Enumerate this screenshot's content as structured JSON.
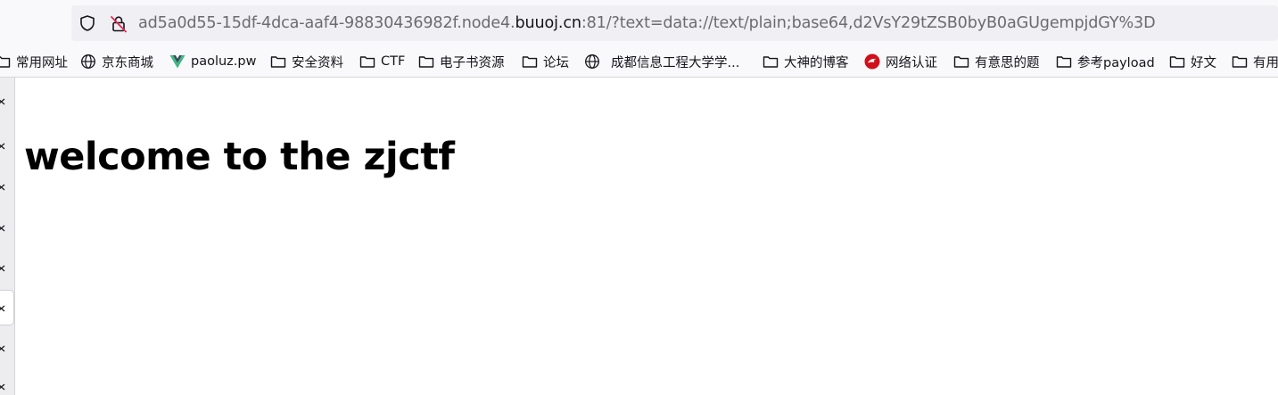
{
  "urlbar": {
    "url_prefix": "ad5a0d55-15df-4dca-aaf4-98830436982f.node4.",
    "url_domain": "buuoj.cn",
    "url_suffix": ":81/?text=data://text/plain;base64,d2VsY29tZSB0byB0aGUgempjdGY%3D",
    "shield_icon": "tracking-protection-shield",
    "lock_icon": "insecure-connection-lock-crossed"
  },
  "bookmarks": [
    {
      "label": "常用网址",
      "icon": "folder"
    },
    {
      "label": "京东商城",
      "icon": "globe"
    },
    {
      "label": "paoluz.pw",
      "icon": "vue-logo"
    },
    {
      "label": "安全资料",
      "icon": "folder"
    },
    {
      "label": "CTF",
      "icon": "folder"
    },
    {
      "label": "电子书资源",
      "icon": "folder"
    },
    {
      "label": "论坛",
      "icon": "folder"
    },
    {
      "label": "成都信息工程大学学...",
      "icon": "globe"
    },
    {
      "label": "大神的博客",
      "icon": "folder"
    },
    {
      "label": "网络认证",
      "icon": "red-bird-logo"
    },
    {
      "label": "有意思的题",
      "icon": "folder"
    },
    {
      "label": "参考payload",
      "icon": "folder"
    },
    {
      "label": "好文",
      "icon": "folder"
    },
    {
      "label": "有用",
      "icon": "folder"
    }
  ],
  "page": {
    "heading": "welcome to the zjctf"
  },
  "colors": {
    "toolbar_bg": "#f9f9fb",
    "urlbar_bg": "#f0f0f4",
    "url_muted": "#6b6b70",
    "url_domain": "#15141a",
    "sidebar_bg": "#ededf0",
    "vue_green": "#41b883",
    "vue_dark": "#35495e",
    "bird_red": "#d0101b"
  }
}
